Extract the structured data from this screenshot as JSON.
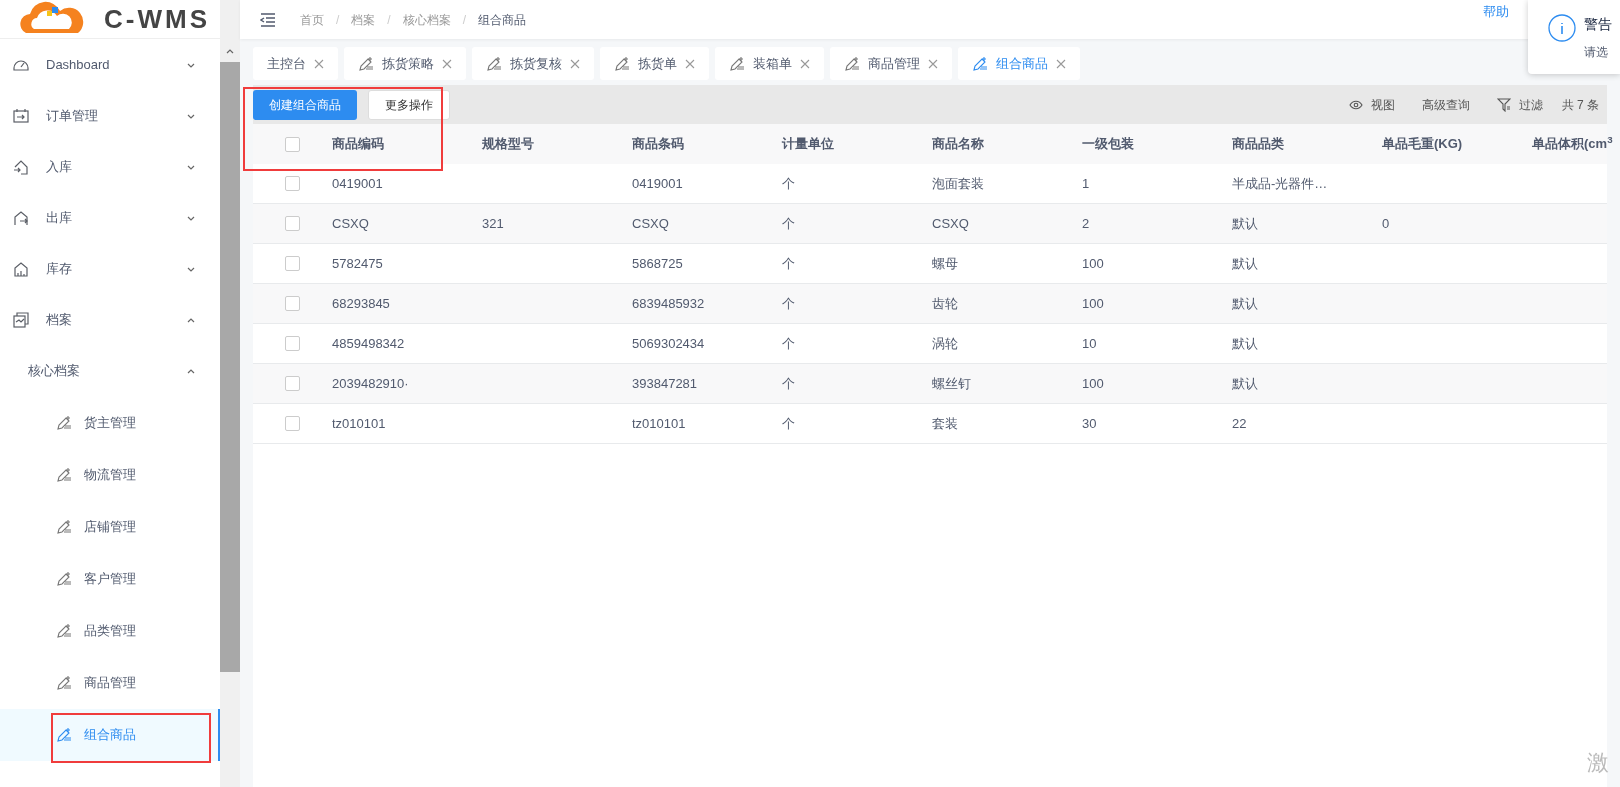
{
  "logo": {
    "text": "C-WMS"
  },
  "sidebar": {
    "items": [
      {
        "label": "Dashboard",
        "expanded": false
      },
      {
        "label": "订单管理",
        "expanded": false
      },
      {
        "label": "入库",
        "expanded": false
      },
      {
        "label": "出库",
        "expanded": false
      },
      {
        "label": "库存",
        "expanded": false
      },
      {
        "label": "档案",
        "expanded": true,
        "children": [
          {
            "label": "核心档案",
            "expanded": true,
            "children": [
              {
                "label": "货主管理",
                "selected": false
              },
              {
                "label": "物流管理",
                "selected": false
              },
              {
                "label": "店铺管理",
                "selected": false
              },
              {
                "label": "客户管理",
                "selected": false
              },
              {
                "label": "品类管理",
                "selected": false
              },
              {
                "label": "商品管理",
                "selected": false
              },
              {
                "label": "组合商品",
                "selected": true
              }
            ]
          }
        ]
      }
    ]
  },
  "header": {
    "breadcrumb": [
      {
        "label": "首页"
      },
      {
        "separator": "/",
        "label": "档案"
      },
      {
        "separator": "/",
        "label": "核心档案"
      },
      {
        "separator": "/",
        "label": "组合商品"
      }
    ],
    "help_link": "帮助"
  },
  "tabs": [
    {
      "label": "主控台",
      "kind": "home",
      "selected": false
    },
    {
      "label": "拣货策略",
      "kind": "page",
      "selected": false
    },
    {
      "label": "拣货复核",
      "kind": "page",
      "selected": false
    },
    {
      "label": "拣货单",
      "kind": "page",
      "selected": false
    },
    {
      "label": "装箱单",
      "kind": "page",
      "selected": false
    },
    {
      "label": "商品管理",
      "kind": "page",
      "selected": false
    },
    {
      "label": "组合商品",
      "kind": "page",
      "selected": true
    }
  ],
  "toolbar": {
    "primary_button": "创建组合商品",
    "secondary_button": "更多操作",
    "tools": [
      {
        "kind": "view",
        "label": "视图"
      },
      {
        "kind": "query",
        "label": "高级查询"
      },
      {
        "kind": "filter",
        "label": "过滤"
      }
    ],
    "total": "共 7 条"
  },
  "table": {
    "select_all_checked": false,
    "columns": [
      "商品编码",
      "规格型号",
      "商品条码",
      "计量单位",
      "商品名称",
      "一级包装",
      "商品品类",
      "单品毛重(KG)",
      "单品体积(cm$^{3}$"
    ],
    "rows": [
      {
        "checked": false,
        "cells": [
          "0419001",
          "",
          "0419001",
          "个",
          "泡面套装",
          "1",
          "半成品-光器件…",
          "",
          ""
        ]
      },
      {
        "checked": false,
        "cells": [
          "CSXQ",
          "321",
          "CSXQ",
          "个",
          "CSXQ",
          "2",
          "默认",
          "0",
          ""
        ]
      },
      {
        "checked": false,
        "cells": [
          "5782475",
          "",
          "5868725",
          "个",
          "螺母",
          "100",
          "默认",
          "",
          ""
        ]
      },
      {
        "checked": false,
        "cells": [
          "68293845",
          "",
          "6839485932",
          "个",
          "齿轮",
          "100",
          "默认",
          "",
          ""
        ]
      },
      {
        "checked": false,
        "cells": [
          "4859498342",
          "",
          "5069302434",
          "个",
          "涡轮",
          "10",
          "默认",
          "",
          ""
        ]
      },
      {
        "checked": false,
        "cells": [
          "2039482910·",
          "",
          "393847281",
          "个",
          "螺丝钉",
          "100",
          "默认",
          "",
          ""
        ]
      },
      {
        "checked": false,
        "cells": [
          "tz010101",
          "",
          "tz010101",
          "个",
          "套装",
          "30",
          "22",
          "",
          ""
        ]
      }
    ]
  },
  "notification": {
    "title": "警告",
    "message": "请选"
  },
  "os_watermark": "激"
}
